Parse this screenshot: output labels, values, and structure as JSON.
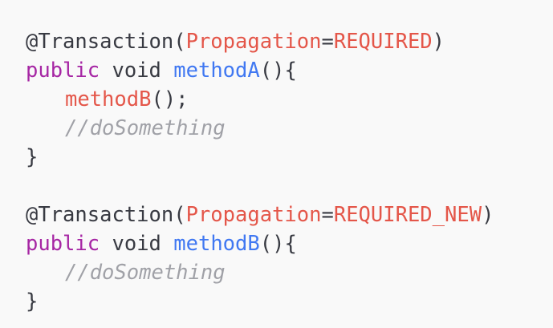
{
  "code": {
    "block1": {
      "annotation": "@Transaction",
      "open_paren": "(",
      "param_name": "Propagation",
      "equals": "=",
      "param_value": "REQUIRED",
      "close_paren": ")",
      "modifier": "public",
      "return_type": "void",
      "method_name": "methodA",
      "signature_tail": "(){",
      "call_name": "methodB",
      "call_tail": "();",
      "comment": "//doSomething",
      "closing_brace": "}"
    },
    "block2": {
      "annotation": "@Transaction",
      "open_paren": "(",
      "param_name": "Propagation",
      "equals": "=",
      "param_value": "REQUIRED_NEW",
      "close_paren": ")",
      "modifier": "public",
      "return_type": "void",
      "method_name": "methodB",
      "signature_tail": "(){",
      "comment": "//doSomething",
      "closing_brace": "}"
    },
    "colors": {
      "background": "#f9f9f9",
      "plain": "#383a42",
      "keyword": "#a626a4",
      "function": "#4078f2",
      "parameter": "#e45649",
      "comment": "#a0a1a7"
    }
  }
}
